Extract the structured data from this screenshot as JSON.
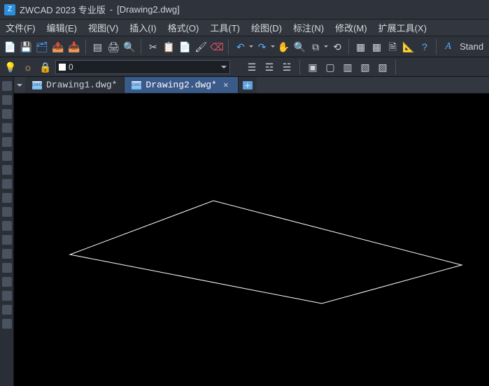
{
  "title": {
    "app": "ZWCAD 2023 专业版",
    "doc": "[Drawing2.dwg]"
  },
  "menus": [
    "文件(F)",
    "编辑(E)",
    "视图(V)",
    "插入(I)",
    "格式(O)",
    "工具(T)",
    "绘图(D)",
    "标注(N)",
    "修改(M)",
    "扩展工具(X)"
  ],
  "toolbar_style_text": "Stand",
  "layer_combo": "0",
  "tabs": {
    "items": [
      {
        "label": "Drawing1.dwg*"
      },
      {
        "label": "Drawing2.dwg*"
      }
    ],
    "active_index": 1
  }
}
